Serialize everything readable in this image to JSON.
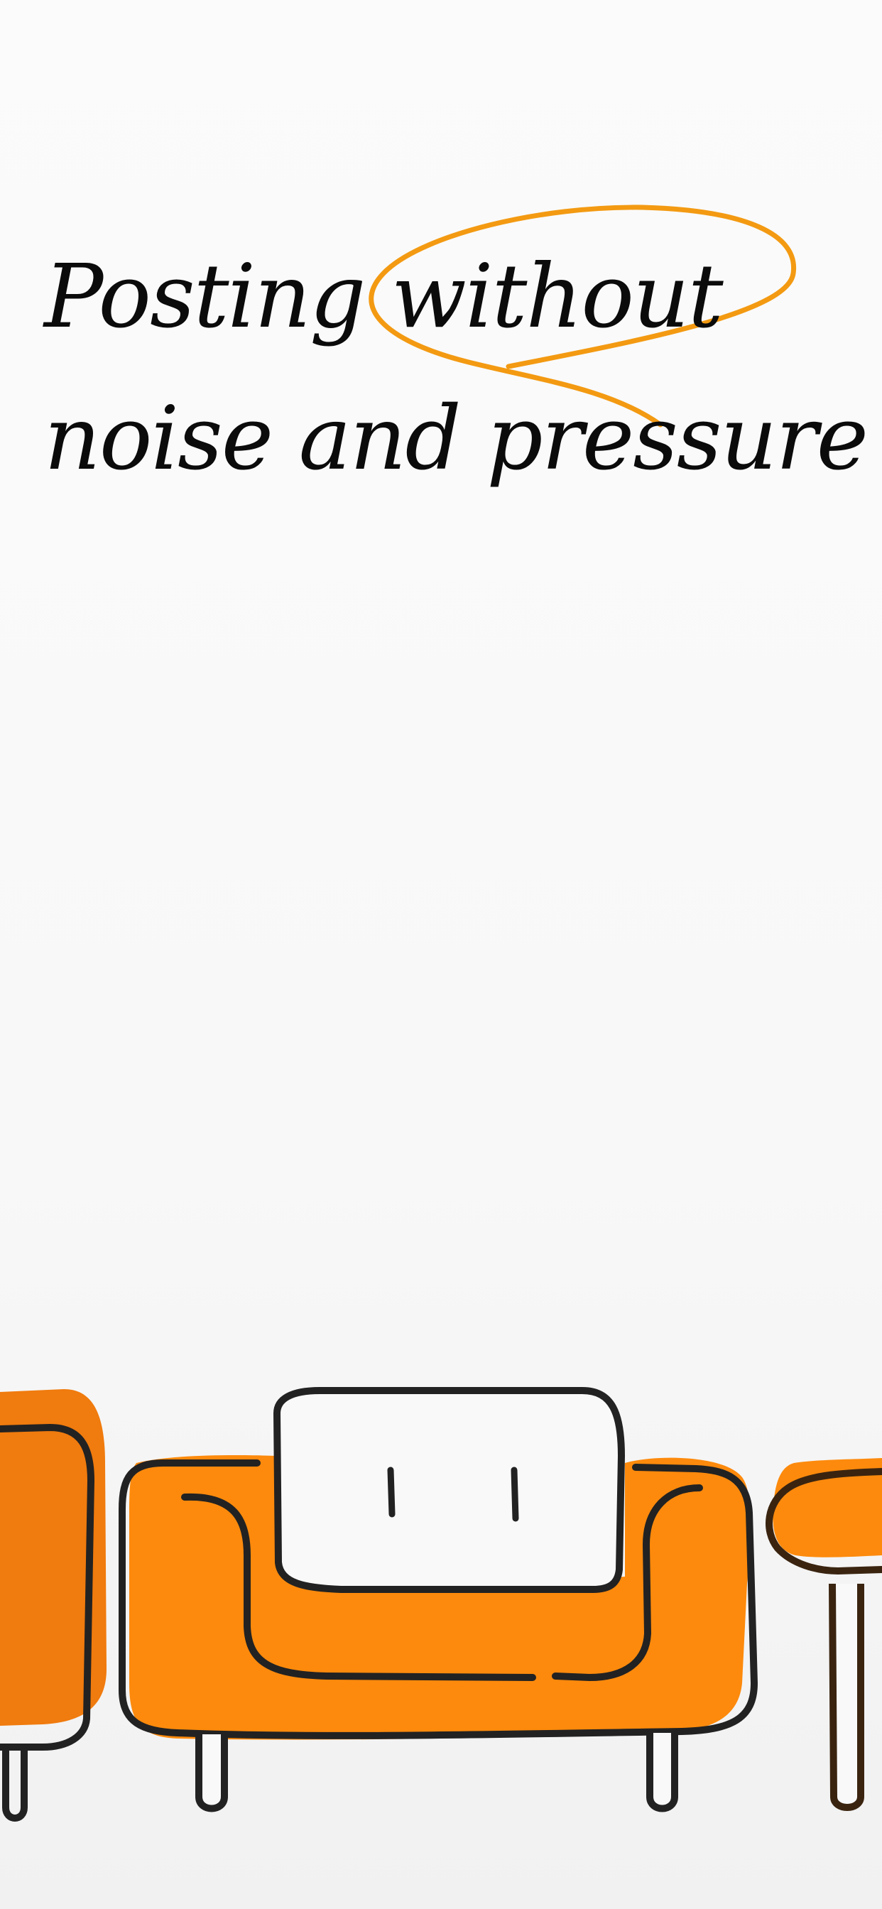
{
  "onboarding": {
    "headline_line1": "Posting without",
    "headline_line2": "noise and pressure"
  },
  "illustration": {
    "name": "orange-sofa-illustration",
    "accent_color": "#ff8c00",
    "outline_color": "#222222"
  },
  "colors": {
    "background": "#f9f9f9",
    "text": "#0b0b0b",
    "highlight_circle": "#f39a12"
  }
}
